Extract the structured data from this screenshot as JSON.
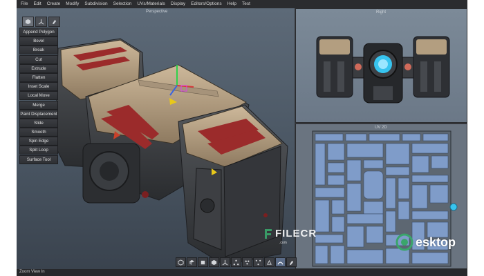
{
  "menubar": {
    "items": [
      "File",
      "Edit",
      "Create",
      "Modify",
      "Subdivision",
      "Selection",
      "UVs/Materials",
      "Display",
      "Editors/Options",
      "Help",
      "Test"
    ]
  },
  "viewports": {
    "perspective": "Perspective",
    "right": "Right",
    "uv": "UV 2D"
  },
  "tool_menu": {
    "items": [
      "Append Polygon",
      "Bevel",
      "Break",
      "Cut",
      "Extrude",
      "Flatten",
      "Inset Scale",
      "Local Move",
      "Merge",
      "Paint Displacement",
      "Slide",
      "Smooth",
      "Spin Edge",
      "Split Loop",
      "Surface Tool"
    ]
  },
  "tool_tabs": {
    "icons": [
      "cube-icon",
      "axis-icon",
      "brush-icon"
    ]
  },
  "bottom_toolbar": {
    "icons": [
      "select-object-icon",
      "select-face-icon",
      "select-edge-icon",
      "select-vertex-icon",
      "move-icon",
      "transform-icon",
      "rotate-icon",
      "scale-icon",
      "tweak-icon",
      "snap-icon",
      "paint-icon"
    ],
    "active_index": 9
  },
  "status": {
    "text": "Zoom View In"
  },
  "watermarks": {
    "filecr": "FILECR",
    "filecr_sub": ".com",
    "desktop": "esktop"
  },
  "colors": {
    "accent": "#5b6c88",
    "menubar": "#2b2c2f",
    "tool_button": "#2e3034",
    "uv_background": "#6a7480",
    "uv_islands": "#7f9cc9"
  }
}
